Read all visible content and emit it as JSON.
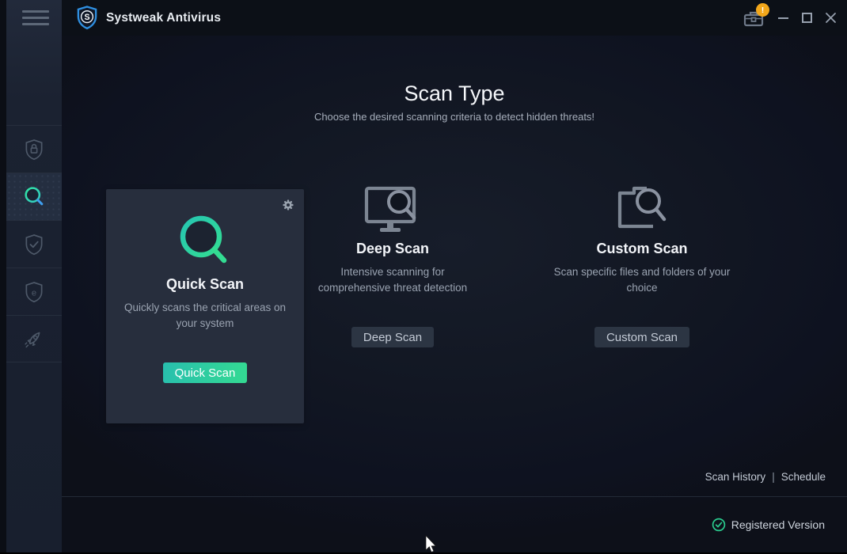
{
  "titlebar": {
    "brand": "Systweak Antivirus",
    "badge": "!"
  },
  "sidebar": {
    "items": [
      {
        "id": "protection",
        "icon": "shield-lock-icon",
        "active": false
      },
      {
        "id": "scan",
        "icon": "search-icon",
        "active": true
      },
      {
        "id": "status",
        "icon": "shield-check-icon",
        "active": false
      },
      {
        "id": "web-protection",
        "icon": "shield-e-icon",
        "active": false
      },
      {
        "id": "optimizer",
        "icon": "rocket-icon",
        "active": false
      }
    ]
  },
  "main": {
    "title": "Scan Type",
    "subtitle": "Choose the desired scanning criteria to detect hidden threats!",
    "cards": [
      {
        "title": "Quick Scan",
        "description": "Quickly scans the critical areas on your system",
        "button_label": "Quick Scan",
        "icon": "magnifier-icon"
      },
      {
        "title": "Deep Scan",
        "description": "Intensive scanning for comprehensive threat detection",
        "button_label": "Deep Scan",
        "icon": "monitor-magnifier-icon"
      },
      {
        "title": "Custom Scan",
        "description": "Scan specific files and folders of your choice",
        "button_label": "Custom Scan",
        "icon": "folder-magnifier-icon"
      }
    ],
    "links": {
      "scan_history": "Scan History",
      "separator": "|",
      "schedule": "Schedule"
    }
  },
  "footer": {
    "registered_label": "Registered Version"
  },
  "colors": {
    "accent_teal": "#2bd3a4",
    "accent_blue": "#2f8fe0",
    "badge_orange": "#f2a71b",
    "success_green": "#2acb8e"
  }
}
